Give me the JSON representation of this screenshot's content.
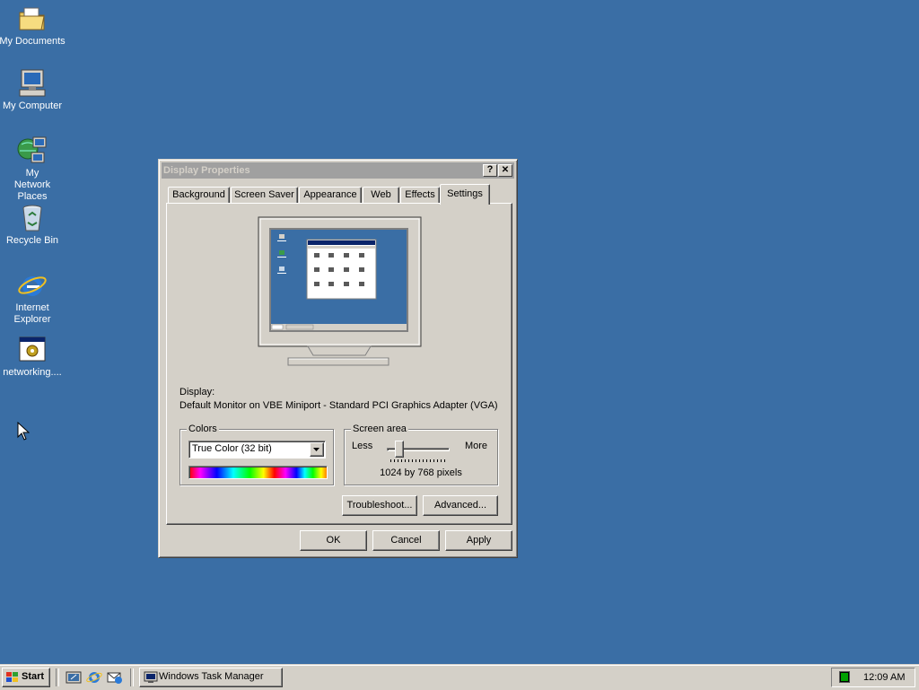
{
  "desktop": {
    "icons": [
      {
        "label": "My Documents"
      },
      {
        "label": "My Computer"
      },
      {
        "label": "My Network Places"
      },
      {
        "label": "Recycle Bin"
      },
      {
        "label": "Internet Explorer"
      },
      {
        "label": "networking...."
      }
    ]
  },
  "dialog": {
    "title": "Display Properties",
    "help_button": "?",
    "close_button": "✕",
    "tabs": [
      {
        "label": "Background"
      },
      {
        "label": "Screen Saver"
      },
      {
        "label": "Appearance"
      },
      {
        "label": "Web"
      },
      {
        "label": "Effects"
      },
      {
        "label": "Settings",
        "active": true
      }
    ],
    "display_label": "Display:",
    "display_value": "Default Monitor on VBE Miniport - Standard PCI Graphics Adapter (VGA)",
    "colors": {
      "legend": "Colors",
      "selected": "True Color (32 bit)"
    },
    "screen_area": {
      "legend": "Screen area",
      "less": "Less",
      "more": "More",
      "value_text": "1024 by 768 pixels",
      "slider_fraction": 0.15
    },
    "troubleshoot_button": "Troubleshoot...",
    "advanced_button": "Advanced...",
    "ok_button": "OK",
    "cancel_button": "Cancel",
    "apply_button": "Apply"
  },
  "taskbar": {
    "start_label": "Start",
    "task_button": "Windows Task Manager",
    "clock": "12:09 AM"
  },
  "colors": {
    "desktop": "#3a6ea5",
    "face": "#d4d0c8",
    "title_inactive": "#a0a0a0"
  }
}
